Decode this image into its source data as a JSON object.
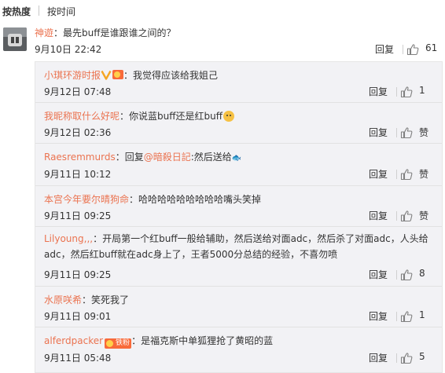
{
  "sort_tabs": [
    {
      "label": "按热度",
      "active": true
    },
    {
      "label": "按时间",
      "active": false
    }
  ],
  "main_comment": {
    "author": "神遊",
    "separator": "：",
    "text": "最先buff是谁跟谁之间的？",
    "time": "9月10日 22:42",
    "reply_label": "回复",
    "like_count": "61"
  },
  "replies": [
    {
      "author": "小琪环游时报",
      "badges": [
        "vip-v",
        "fan-badge-mini"
      ],
      "text": "我觉得应该给我姐己",
      "time": "9月12日 07:48",
      "reply_label": "回复",
      "like_label": "1"
    },
    {
      "author": "我昵称取什么好呢",
      "badges": [],
      "text": "你说蓝buff还是红buff",
      "emoji": "cat-face",
      "time": "9月12日 02:36",
      "reply_label": "回复",
      "like_label": "赞"
    },
    {
      "author": "Raesremmurds",
      "badges": [],
      "text_prefix": "回复",
      "mention": "@暗殺日記",
      "text": ":然后送给",
      "emoji": "fish",
      "time": "9月11日 10:12",
      "reply_label": "回复",
      "like_label": "赞"
    },
    {
      "author": "本宫今年要尔晴狗命",
      "badges": [],
      "text": "哈哈哈哈哈哈哈哈哈嘴头笑掉",
      "time": "9月11日 09:25",
      "reply_label": "回复",
      "like_label": "赞"
    },
    {
      "author": "Lilyoung,,,",
      "badges": [],
      "text": "开局第一个红buff一般给辅助，然后送给对面adc，然后杀了对面adc，人头给adc，然后红buff就在adc身上了，王者5000分总结的经验，不喜勿喷",
      "time": "9月11日 09:25",
      "reply_label": "回复",
      "like_label": "8"
    },
    {
      "author": "水原咲希",
      "badges": [],
      "text": "笑死我了",
      "time": "9月11日 09:01",
      "reply_label": "回复",
      "like_label": "1"
    },
    {
      "author": "alferdpacker",
      "badges": [
        "fan-badge"
      ],
      "fan_badge_text": "铁粉",
      "text": "是福克斯中单狐狸抢了黄昭的蓝",
      "time": "9月11日 05:48",
      "reply_label": "回复",
      "like_label": "5"
    }
  ],
  "colors": {
    "username": "#eb7350",
    "text": "#333333",
    "sub_bg": "#f2f2f5",
    "badge_orange": "#f86a3a"
  },
  "icons": {
    "like": "thumbs-up-icon",
    "verified": "vip-v-icon",
    "fan": "fan-badge-icon"
  }
}
